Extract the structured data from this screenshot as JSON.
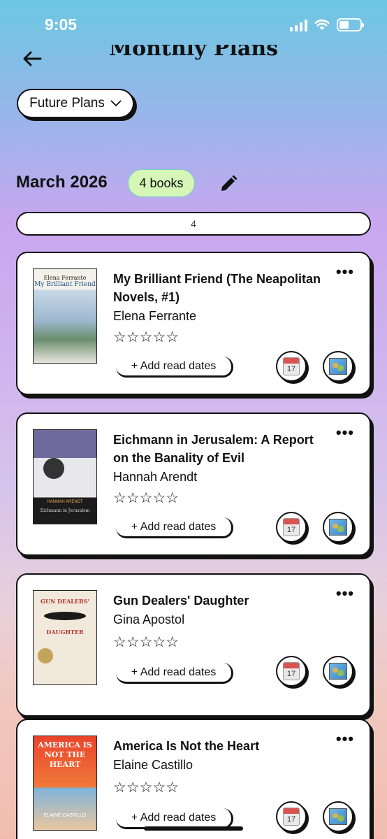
{
  "status_bar": {
    "time": "9:05"
  },
  "header": {
    "title": "Monthly Plans",
    "back_icon": "arrow-left-icon"
  },
  "filter": {
    "label": "Future Plans",
    "icon": "chevron-down-icon"
  },
  "month": {
    "title": "March 2026",
    "count_label": "4 books",
    "edit_icon": "pencil-icon"
  },
  "progress": {
    "label": "4"
  },
  "books": [
    {
      "title": "My Brilliant Friend (The Neapolitan Novels, #1)",
      "author": "Elena Ferrante",
      "rating": 0,
      "stars": "☆☆☆☆☆",
      "add_dates": "+ Add read dates",
      "more": "•••",
      "cover_top": "Elena Ferrante",
      "cover_sub": "My Brilliant Friend",
      "calendar_day": "17"
    },
    {
      "title": "Eichmann in Jerusalem: A Report on the Banality of Evil",
      "author": "Hannah Arendt",
      "rating": 0,
      "stars": "☆☆☆☆☆",
      "add_dates": "+ Add read dates",
      "more": "•••",
      "cover_top": "HANNAH ARENDT",
      "cover_sub": "Eichmann in Jerusalem",
      "calendar_day": "17"
    },
    {
      "title": "Gun Dealers' Daughter",
      "author": "Gina Apostol",
      "rating": 0,
      "stars": "☆☆☆☆☆",
      "add_dates": "+ Add read dates",
      "more": "•••",
      "cover_top": "GUN DEALERS'",
      "cover_sub": "DAUGHTER",
      "calendar_day": "17"
    },
    {
      "title": "America Is Not the Heart",
      "author": "Elaine Castillo",
      "rating": 0,
      "stars": "☆☆☆☆☆",
      "add_dates": "+ Add read dates",
      "more": "•••",
      "cover_top": "AMERICA IS NOT THE HEART",
      "cover_sub": "ELAINE CASTILLO",
      "calendar_day": "17"
    }
  ]
}
